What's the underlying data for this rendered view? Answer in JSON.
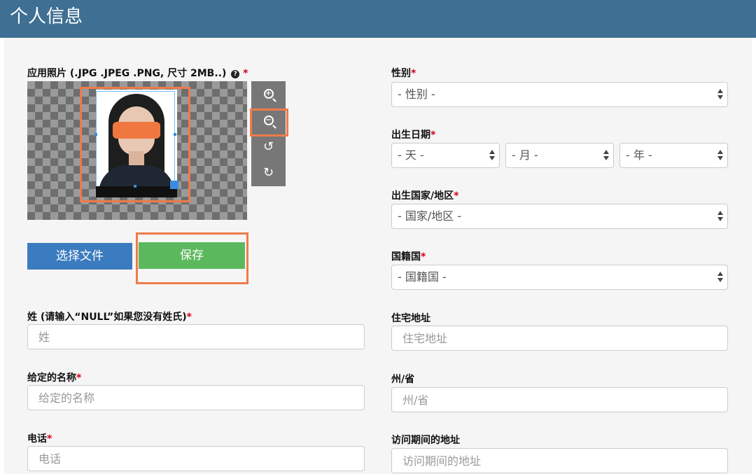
{
  "header": {
    "title": "个人信息"
  },
  "photo": {
    "label": "应用照片 (.JPG .JPEG .PNG, 尺寸 2MB..)",
    "help_icon": "?",
    "required_mark": "*",
    "tools": [
      "zoom-in-icon",
      "zoom-out-icon",
      "rotate-left-icon",
      "rotate-right-icon"
    ],
    "choose_file_label": "选择文件",
    "save_label": "保存"
  },
  "left_fields": {
    "surname": {
      "label": "姓 (请输入“NULL”如果您没有姓氏)",
      "required": "*",
      "placeholder": "姓"
    },
    "given_name": {
      "label": "给定的名称",
      "required": "*",
      "placeholder": "给定的名称"
    },
    "phone": {
      "label": "电话",
      "required": "*",
      "placeholder": "电话"
    }
  },
  "right_fields": {
    "gender": {
      "label": "性别",
      "required": "*",
      "value": "- 性别 -"
    },
    "birth_date": {
      "label": "出生日期",
      "required": "*",
      "day": "- 天 -",
      "month": "- 月 -",
      "year": "- 年 -"
    },
    "birth_country": {
      "label": "出生国家/地区",
      "required": "*",
      "value": "- 国家/地区 -"
    },
    "nationality": {
      "label": "国籍国",
      "required": "*",
      "value": "- 国籍国 -"
    },
    "home_address": {
      "label": "住宅地址",
      "placeholder": "住宅地址"
    },
    "state": {
      "label": "州/省",
      "placeholder": "州/省"
    },
    "visit_address": {
      "label": "访问期间的地址",
      "placeholder": "访问期间的地址"
    }
  },
  "colors": {
    "header": "#3f6f92",
    "highlight": "#f07a4a",
    "primary": "#3b7bbf",
    "success": "#5cb85c",
    "required": "#d0021b"
  }
}
